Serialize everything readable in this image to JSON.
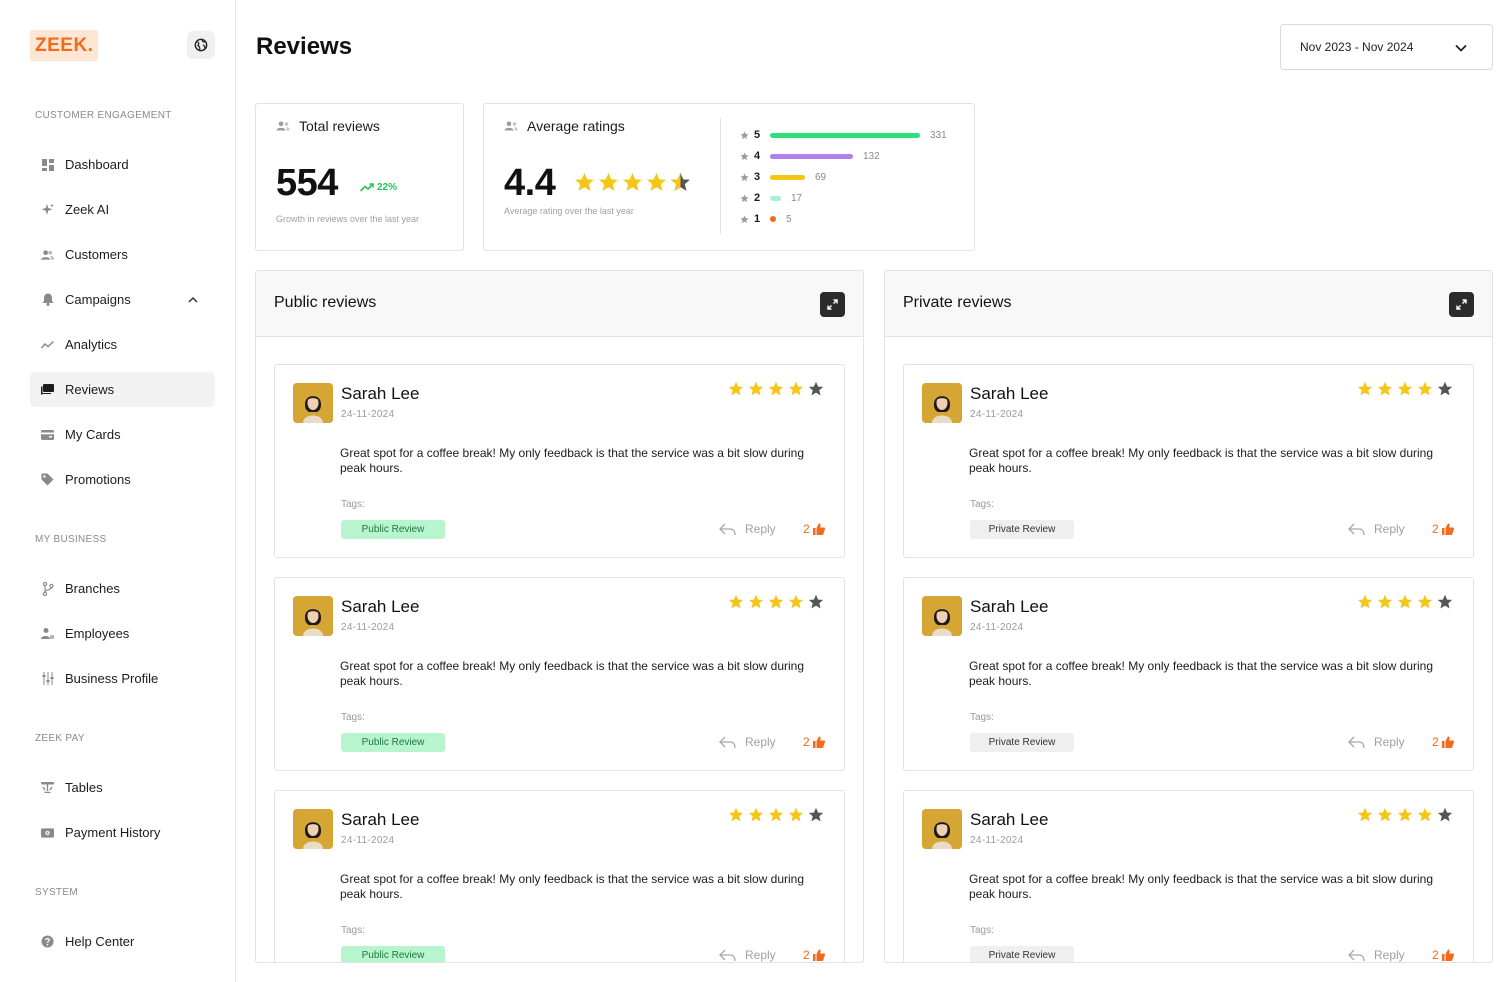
{
  "sidebar": {
    "logo": "ZEEK.",
    "sections": {
      "customer_engagement": "CUSTOMER ENGAGEMENT",
      "my_business": "MY BUSINESS",
      "zeek_pay": "ZEEK PAY",
      "system": "SYSTEM"
    },
    "items": {
      "dashboard": "Dashboard",
      "zeek_ai": "Zeek AI",
      "customers": "Customers",
      "campaigns": "Campaigns",
      "analytics": "Analytics",
      "reviews": "Reviews",
      "my_cards": "My Cards",
      "promotions": "Promotions",
      "branches": "Branches",
      "employees": "Employees",
      "business_profile": "Business Profile",
      "tables": "Tables",
      "payment_history": "Payment History",
      "help_center": "Help Center"
    },
    "active_item": "Reviews"
  },
  "header": {
    "title": "Reviews",
    "date_range": "Nov 2023 - Nov 2024"
  },
  "stats": {
    "total_reviews": {
      "title": "Total reviews",
      "value": "554",
      "growth": "22%",
      "caption": "Growth in reviews over the last year"
    },
    "average_ratings": {
      "title": "Average ratings",
      "value": "4.4",
      "rating": 4.4,
      "caption": "Average rating over the last year",
      "distribution": [
        {
          "stars": "5",
          "count": "331",
          "fraction": 1.0,
          "color": "#2ee07a"
        },
        {
          "stars": "4",
          "count": "132",
          "fraction": 0.55,
          "color": "#b07ff0"
        },
        {
          "stars": "3",
          "count": "69",
          "fraction": 0.23,
          "color": "#f5c518"
        },
        {
          "stars": "2",
          "count": "17",
          "fraction": 0.07,
          "color": "#a8f0d4"
        },
        {
          "stars": "1",
          "count": "5",
          "fraction": 0.02,
          "color": "#f26a1b"
        }
      ]
    }
  },
  "colors": {
    "star_filled": "#f5c518",
    "star_empty": "#555555",
    "accent": "#f26a1b"
  },
  "public_reviews": {
    "title": "Public reviews",
    "reviews": [
      {
        "name": "Sarah Lee",
        "date": "24-11-2024",
        "rating": 4,
        "text": "Great spot for a coffee break! My only feedback is that the service was a bit slow during peak hours.",
        "tags_label": "Tags:",
        "tag": "Public Review",
        "reply": "Reply",
        "likes": "2"
      },
      {
        "name": "Sarah Lee",
        "date": "24-11-2024",
        "rating": 4,
        "text": "Great spot for a coffee break! My only feedback is that the service was a bit slow during peak hours.",
        "tags_label": "Tags:",
        "tag": "Public Review",
        "reply": "Reply",
        "likes": "2"
      },
      {
        "name": "Sarah Lee",
        "date": "24-11-2024",
        "rating": 4,
        "text": "Great spot for a coffee break! My only feedback is that the service was a bit slow during peak hours.",
        "tags_label": "Tags:",
        "tag": "Public Review",
        "reply": "Reply",
        "likes": "2"
      }
    ]
  },
  "private_reviews": {
    "title": "Private reviews",
    "reviews": [
      {
        "name": "Sarah Lee",
        "date": "24-11-2024",
        "rating": 4,
        "text": "Great spot for a coffee break! My only feedback is that the service was a bit slow during peak hours.",
        "tags_label": "Tags:",
        "tag": "Private Review",
        "reply": "Reply",
        "likes": "2"
      },
      {
        "name": "Sarah Lee",
        "date": "24-11-2024",
        "rating": 4,
        "text": "Great spot for a coffee break! My only feedback is that the service was a bit slow during peak hours.",
        "tags_label": "Tags:",
        "tag": "Private Review",
        "reply": "Reply",
        "likes": "2"
      },
      {
        "name": "Sarah Lee",
        "date": "24-11-2024",
        "rating": 4,
        "text": "Great spot for a coffee break! My only feedback is that the service was a bit slow during peak hours.",
        "tags_label": "Tags:",
        "tag": "Private Review",
        "reply": "Reply",
        "likes": "2"
      }
    ]
  }
}
